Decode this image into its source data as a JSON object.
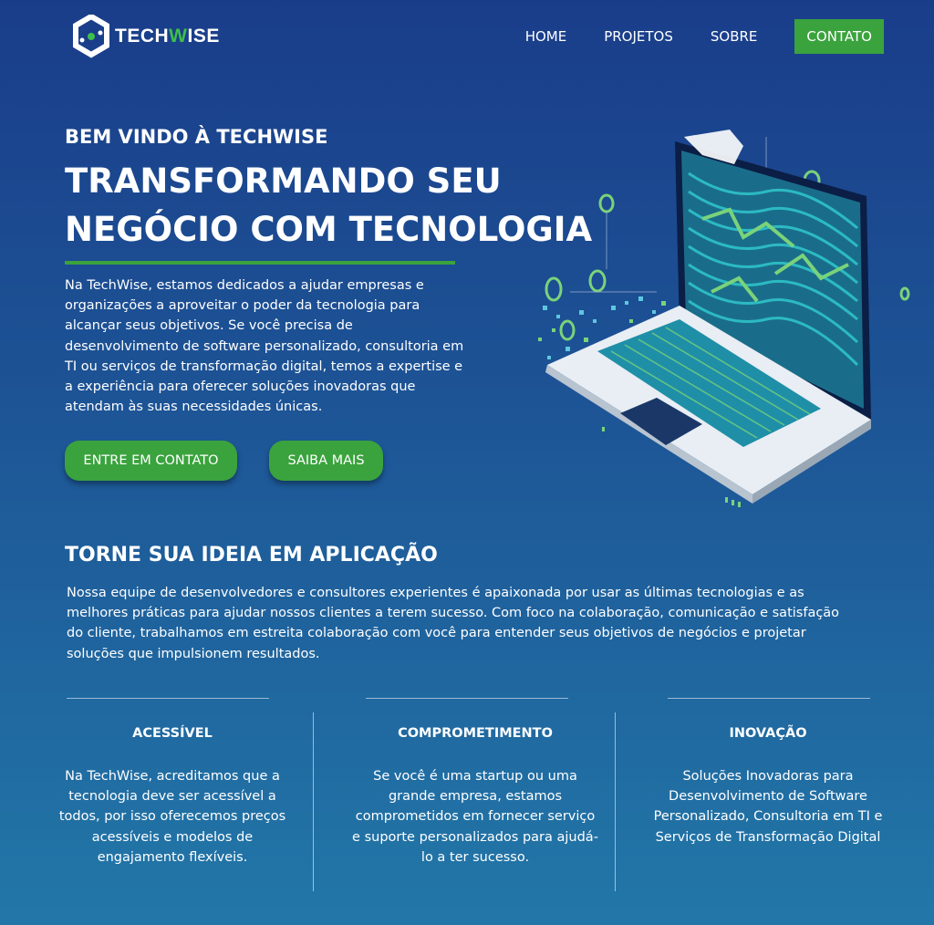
{
  "header": {
    "logo": {
      "text_main": "TECH",
      "text_accent": "W",
      "text_end": "ISE"
    },
    "nav": [
      {
        "label": "HOME"
      },
      {
        "label": "PROJETOS"
      },
      {
        "label": "SOBRE"
      },
      {
        "label": "CONTATO"
      }
    ]
  },
  "hero": {
    "kicker": "BEM VINDO À TECHWISE",
    "headline_line1": "TRANSFORMANDO SEU",
    "headline_line2": "NEGÓCIO COM TECNOLOGIA",
    "text": "Na TechWise, estamos dedicados a ajudar empresas e organizações a aproveitar o poder da tecnologia para alcançar seus objetivos. Se você precisa de desenvolvimento de software personalizado, consultoria em TI ou serviços de transformação digital, temos a expertise e a experiência para oferecer soluções inovadoras que atendam às suas necessidades únicas.",
    "button_contact": "ENTRE EM CONTATO",
    "button_more": "SAIBA MAIS"
  },
  "section": {
    "title": "TORNE SUA IDEIA EM APLICAÇÃO",
    "text": "Nossa equipe de desenvolvedores e consultores experientes é apaixonada por usar as últimas tecnologias e as melhores práticas para ajudar nossos clientes a terem sucesso. Com foco na colaboração, comunicação e satisfação do cliente, trabalhamos em estreita colaboração com você para entender seus objetivos de negócios e projetar soluções que impulsionem resultados."
  },
  "features": [
    {
      "title": "ACESSÍVEL",
      "text": "Na TechWise, acreditamos que a tecnologia deve ser acessível a todos, por isso oferecemos preços acessíveis e modelos de engajamento flexíveis."
    },
    {
      "title": "COMPROMETIMENTO",
      "text": "Se você é uma startup ou uma grande empresa, estamos comprometidos em fornecer serviço e suporte personalizados para ajudá-lo a ter sucesso."
    },
    {
      "title": "INOVAÇÃO",
      "text": "Soluções Inovadoras para Desenvolvimento de Software Personalizado, Consultoria em TI e Serviços de Transformação Digital"
    }
  ],
  "colors": {
    "accent": "#3aa33d",
    "bg_top": "#1a3d8a",
    "bg_bottom": "#2277a8"
  }
}
